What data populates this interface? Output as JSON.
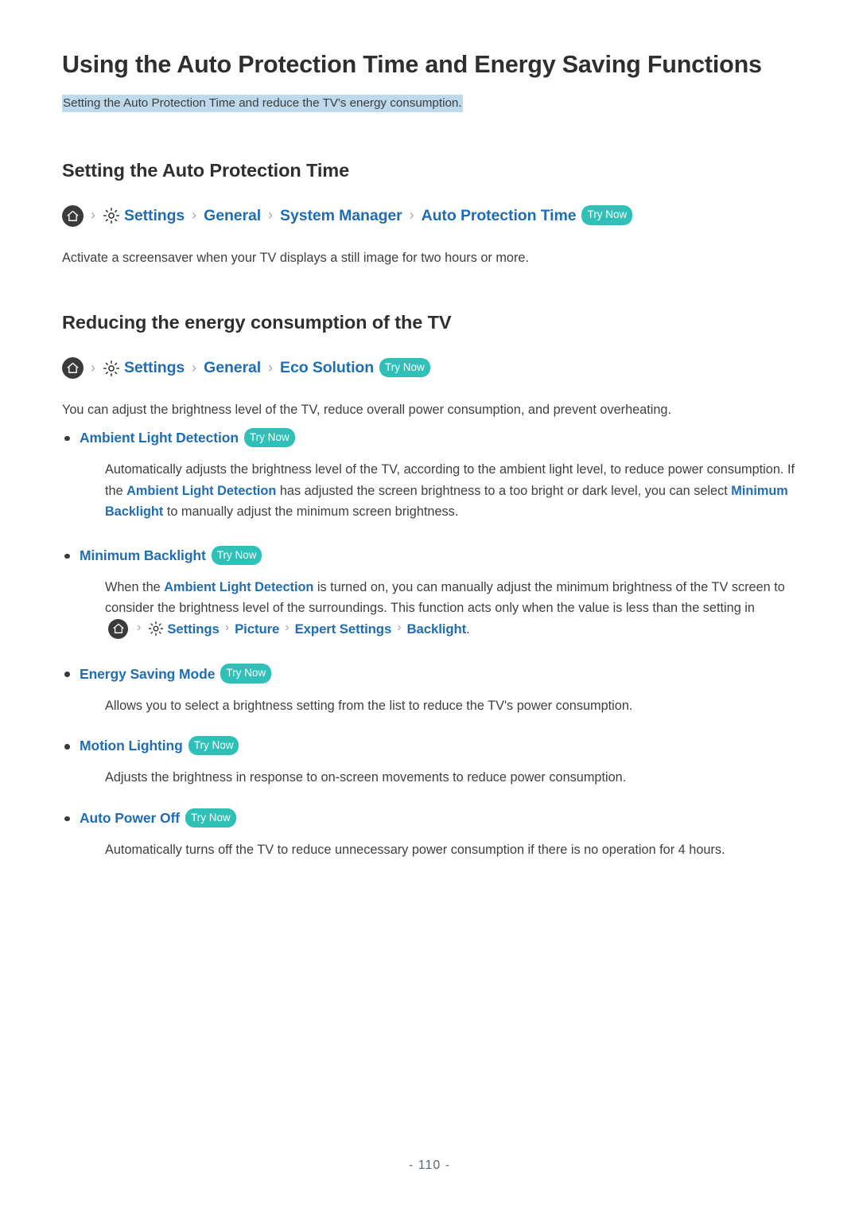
{
  "document": {
    "title": "Using the Auto Protection Time and Energy Saving Functions",
    "subtitle": "Setting the Auto Protection Time and reduce the TV's energy consumption.",
    "page_number": "- 110 -"
  },
  "colors": {
    "link_blue": "#1f6db5",
    "badge_teal": "#2fc0b8",
    "highlight_blue": "#bed9ec",
    "heading_dark": "#2f2f2f",
    "body_text": "#3f3f3f"
  },
  "icons": {
    "home": "home-icon",
    "gear": "gear-icon",
    "separator": "›",
    "bullet": "•"
  },
  "badges": {
    "try_now": "Try Now"
  },
  "sections": [
    {
      "heading": "Setting the Auto Protection Time",
      "breadcrumb": [
        "Settings",
        "General",
        "System Manager",
        "Auto Protection Time"
      ],
      "paragraph": "Activate a screensaver when your TV displays a still image for two hours or more."
    },
    {
      "heading": "Reducing the energy consumption of the TV",
      "breadcrumb": [
        "Settings",
        "General",
        "Eco Solution"
      ],
      "paragraph": "You can adjust the brightness level of the TV, reduce overall power consumption, and prevent overheating."
    }
  ],
  "features": [
    {
      "title": "Ambient Light Detection",
      "body_parts": [
        {
          "text": "Automatically adjusts the brightness level of the TV, according to the ambient light level, to reduce power consumption. If the ",
          "link": false
        },
        {
          "text": "Ambient Light Detection",
          "link": true
        },
        {
          "text": " has adjusted the screen brightness to a too bright or dark level, you can select ",
          "link": false
        },
        {
          "text": "Minimum Backlight",
          "link": true
        },
        {
          "text": " to manually adjust the minimum screen brightness.",
          "link": false
        }
      ]
    },
    {
      "title": "Minimum Backlight",
      "body_parts": [
        {
          "text": "When the ",
          "link": false
        },
        {
          "text": "Ambient Light Detection",
          "link": true
        },
        {
          "text": " is turned on, you can manually adjust the minimum brightness of the TV screen to consider the brightness level of the surroundings. This function acts only when the value is less than the setting in ",
          "link": false
        }
      ],
      "inline_breadcrumb": [
        "Settings",
        "Picture",
        "Expert Settings",
        "Backlight"
      ],
      "body_tail": "."
    },
    {
      "title": "Energy Saving Mode",
      "body_parts": [
        {
          "text": "Allows you to select a brightness setting from the list to reduce the TV's power consumption.",
          "link": false
        }
      ]
    },
    {
      "title": "Motion Lighting",
      "body_parts": [
        {
          "text": "Adjusts the brightness in response to on-screen movements to reduce power consumption.",
          "link": false
        }
      ]
    },
    {
      "title": "Auto Power Off",
      "body_parts": [
        {
          "text": "Automatically turns off the TV to reduce unnecessary power consumption if there is no operation for 4 hours.",
          "link": false
        }
      ]
    }
  ]
}
